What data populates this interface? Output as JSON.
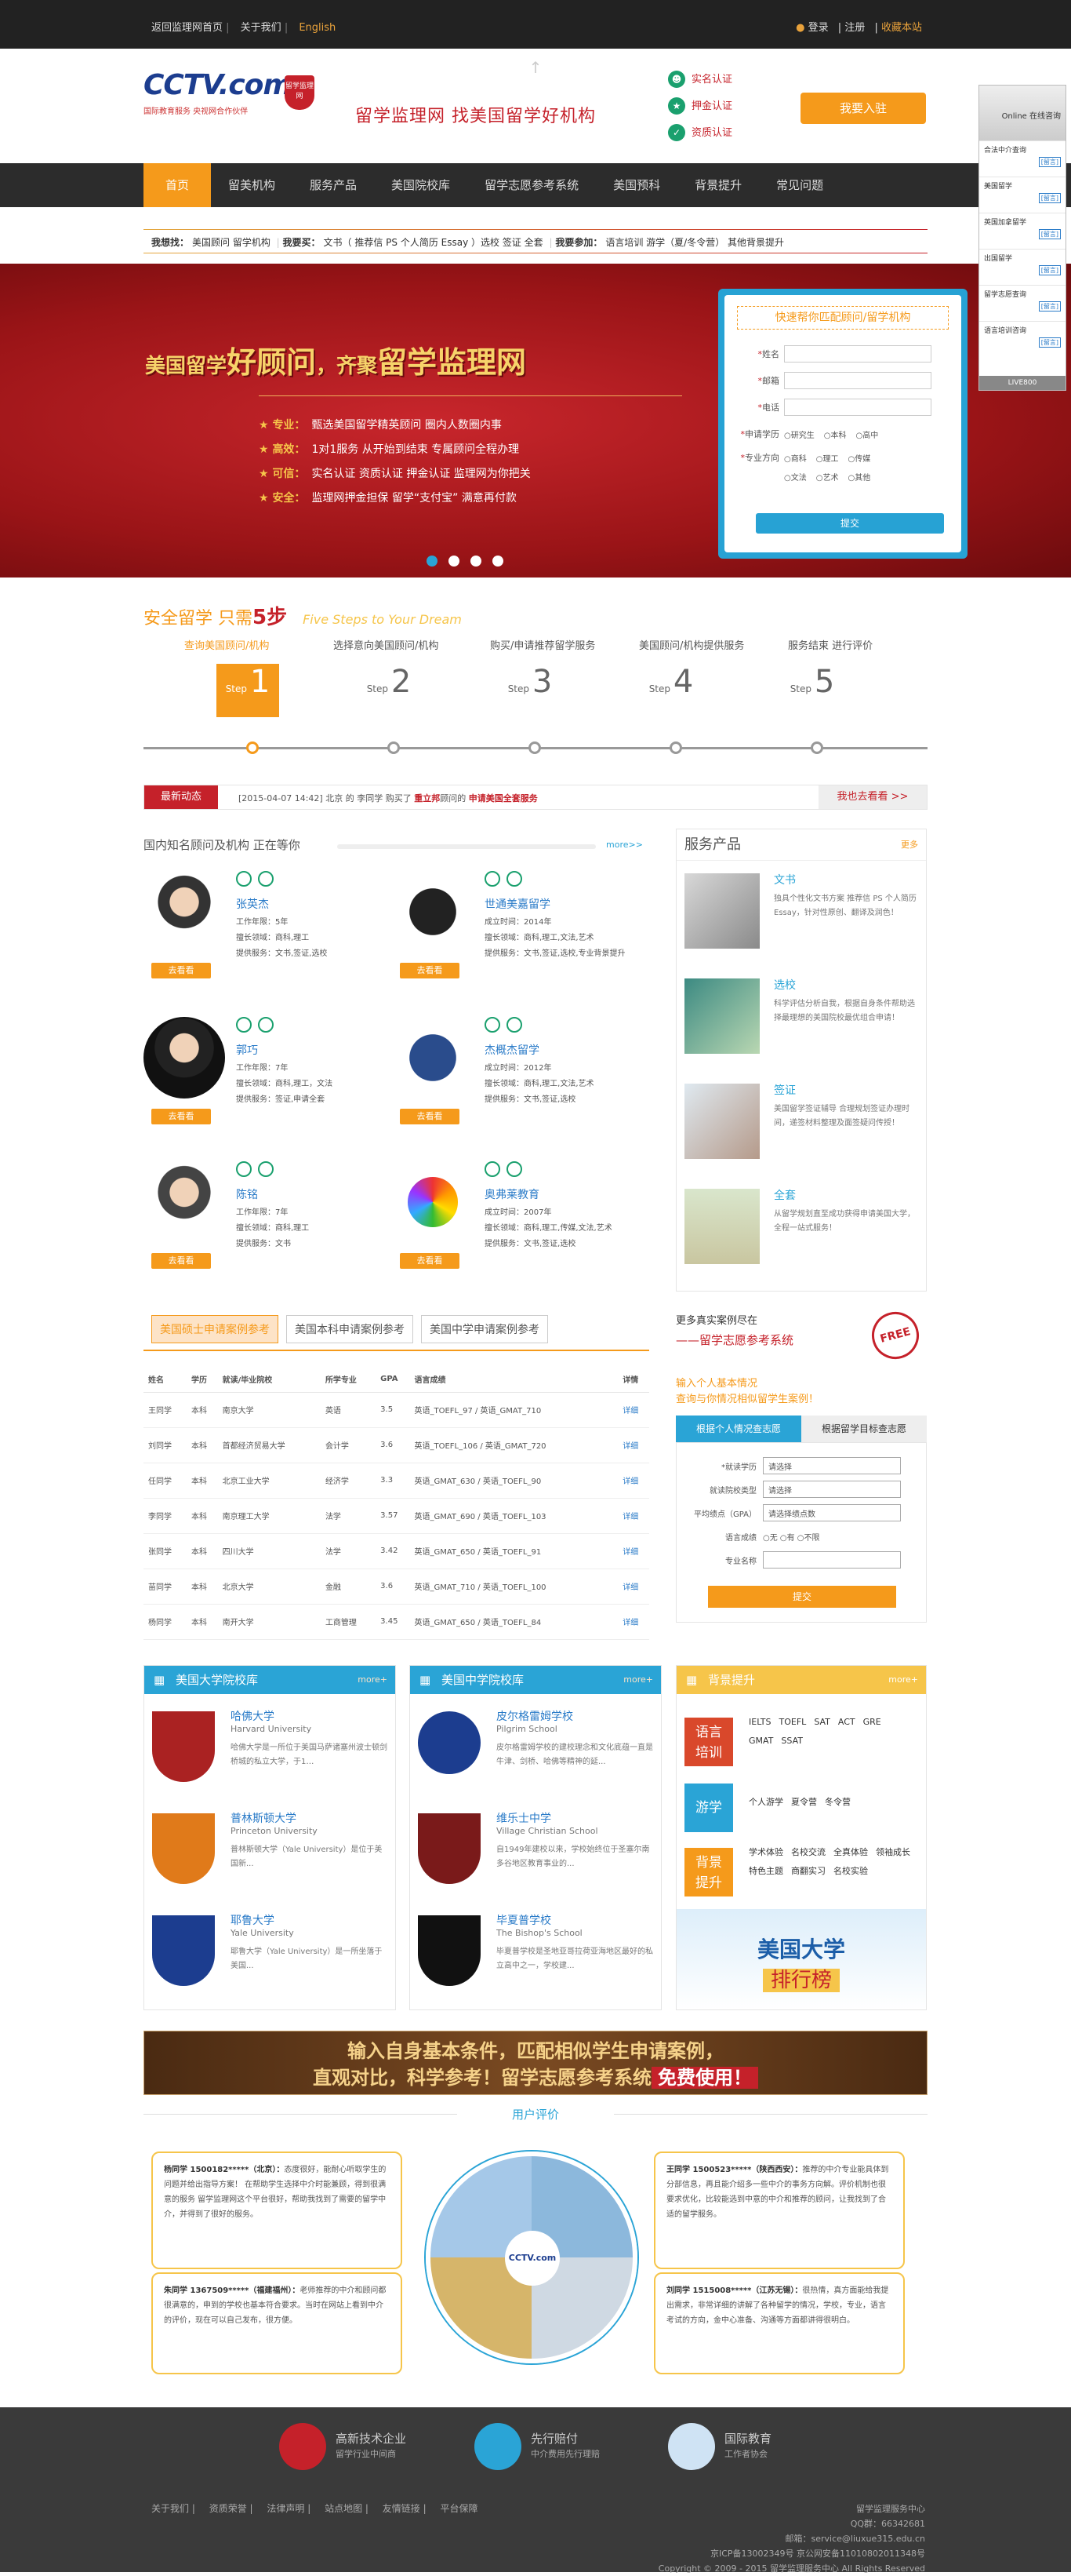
{
  "topbar": {
    "home": "返回监理网首页",
    "about": "关于我们",
    "english": "English",
    "login": "登录",
    "register": "注册",
    "favorite": "收藏本站"
  },
  "header": {
    "logo_text": "CCTV.com",
    "logo_sub": "国际教育服务   央视网合作伙伴",
    "badge": "留学监理网",
    "slogan": "留学监理网   找美国留学好机构",
    "certs": [
      "实名认证",
      "押金认证",
      "资质认证"
    ],
    "join": "我要入驻"
  },
  "nav": [
    "首页",
    "留美机构",
    "服务产品",
    "美国院校库",
    "留学志愿参考系统",
    "美国预科",
    "背景提升",
    "常见问题"
  ],
  "search_hot": {
    "l1": "我想找：",
    "v1": "美国顾问  留学机构",
    "l2": "我要买：",
    "v2": "文书（ 推荐信  PS  个人简历  Essay ）选校  签证  全套",
    "l3": "我要参加：",
    "v3": "语言培训  游学（夏/冬令营）  其他背景提升"
  },
  "banner": {
    "title_a": "美国留学",
    "title_b": "好顾问",
    "title_c": "，齐聚",
    "title_d": "留学监理网",
    "points": [
      [
        "专业：",
        "甄选美国留学精英顾问  圈内人数圈内事"
      ],
      [
        "高效：",
        "1对1服务  从开始到结束  专属顾问全程办理"
      ],
      [
        "可信：",
        "实名认证  资质认证  押金认证  监理网为你把关"
      ],
      [
        "安全：",
        "监理网押金担保  留学“支付宝”  满意再付款"
      ]
    ]
  },
  "form": {
    "title": "快速帮你匹配顾问/留学机构",
    "name": "姓名",
    "email": "邮箱",
    "phone": "电话",
    "degree": "申请学历",
    "degree_opts": [
      "研究生",
      "本科",
      "高中"
    ],
    "major": "专业方向",
    "major_opts": [
      "商科",
      "理工",
      "传媒",
      "文法",
      "艺术",
      "其他"
    ],
    "submit": "提交"
  },
  "side": {
    "online": "Online 在线咨询",
    "services": [
      "合法中介查询",
      "美国留学",
      "英国加拿留学",
      "出国留学",
      "留学志愿查询",
      "语言培训咨询"
    ],
    "ask": "[留言]",
    "live": "LIVE800"
  },
  "steps": {
    "title": "安全留学   只需",
    "five": "5步",
    "en": "Five Steps to Your Dream",
    "labels": [
      "查询美国顾问/机构",
      "选择意向美国顾问/机构",
      "购买/申请推荐留学服务",
      "美国顾问/机构提供服务",
      "服务结束  进行评价"
    ],
    "nums": [
      "1",
      "2",
      "3",
      "4",
      "5"
    ],
    "step_word": "Step"
  },
  "news": {
    "tag": "最新动态",
    "date": "[2015-04-07 14:42]",
    "text_a": "北京 的 李同学 购买了",
    "org": "重立邦",
    "text_b": "顾问的",
    "svc": "申请美国全套服务",
    "more": "我也去看看 >>"
  },
  "advisors": {
    "title": "国内知名顾问及机构  正在等你",
    "more": "more>>",
    "go": "去看看",
    "list": [
      {
        "name": "张英杰",
        "info": [
          "工作年限：5年",
          "擅长领域：商科,理工",
          "提供服务：文书,签证,选校"
        ]
      },
      {
        "name": "世通美嘉留学",
        "info": [
          "成立时间：2014年",
          "擅长领域：商科,理工,文法,艺术",
          "提供服务：文书,签证,选校,专业背景提升"
        ]
      },
      {
        "name": "郭巧",
        "info": [
          "工作年限：7年",
          "擅长领域：商科,理工，文法",
          "提供服务：签证,申请全套"
        ]
      },
      {
        "name": "杰概杰留学",
        "info": [
          "成立时间：2012年",
          "擅长领域：商科,理工,文法,艺术",
          "提供服务：文书,签证,选校"
        ]
      },
      {
        "name": "陈铭",
        "info": [
          "工作年限：7年",
          "擅长领域：商科,理工",
          "提供服务：文书"
        ]
      },
      {
        "name": "奥弗莱教育",
        "info": [
          "成立时间：2007年",
          "擅长领域：商科,理工,传媒,文法,艺术",
          "提供服务：文书,签证,选校"
        ]
      }
    ]
  },
  "services": {
    "title": "服务产品",
    "more": "更多",
    "items": [
      {
        "t": "文书",
        "d": "独具个性化文书方案 推荐信 PS 个人简历 Essay，针对性原创、翻译及润色！"
      },
      {
        "t": "选校",
        "d": "科学评估分析自我，根据自身条件帮助选择最理想的美国院校最优组合申请！"
      },
      {
        "t": "签证",
        "d": "美国留学签证辅导 合理规划签证办理时间，递签材料整理及面签疑问传授！"
      },
      {
        "t": "全套",
        "d": "从留学规划直至成功获得申请美国大学，全程一站式服务！"
      }
    ]
  },
  "case_tabs": [
    "美国硕士申请案例参考",
    "美国本科申请案例参考",
    "美国中学申请案例参考"
  ],
  "case_table": {
    "headers": [
      "姓名",
      "学历",
      "就读/毕业院校",
      "所学专业",
      "GPA",
      "语言成绩",
      "详情"
    ],
    "rows": [
      [
        "王同学",
        "本科",
        "南京大学",
        "英语",
        "3.5",
        "英语_TOEFL_97 / 英语_GMAT_710",
        "详细"
      ],
      [
        "刘同学",
        "本科",
        "首都经济贸易大学",
        "会计学",
        "3.6",
        "英语_TOEFL_106 / 英语_GMAT_720",
        "详细"
      ],
      [
        "任同学",
        "本科",
        "北京工业大学",
        "经济学",
        "3.3",
        "英语_GMAT_630 / 英语_TOEFL_90",
        "详细"
      ],
      [
        "李同学",
        "本科",
        "南京理工大学",
        "法学",
        "3.57",
        "英语_GMAT_690 / 英语_TOEFL_103",
        "详细"
      ],
      [
        "张同学",
        "本科",
        "四川大学",
        "法学",
        "3.42",
        "英语_GMAT_650 / 英语_TOEFL_91",
        "详细"
      ],
      [
        "苗同学",
        "本科",
        "北京大学",
        "金融",
        "3.6",
        "英语_GMAT_710 / 英语_TOEFL_100",
        "详细"
      ],
      [
        "杨同学",
        "本科",
        "南开大学",
        "工商管理",
        "3.45",
        "英语_GMAT_650 / 英语_TOEFL_84",
        "详细"
      ]
    ]
  },
  "case_search": {
    "t1": "更多真实案例尽在",
    "t2": "——留学志愿参考系统",
    "free": "FREE",
    "t3a": "输入个人基本情况",
    "t3b": "查询与你情况相似留学生案例！",
    "tab1": "根据个人情况查志愿",
    "tab2": "根据留学目标查志愿",
    "rows": [
      [
        "*就读学历",
        "请选择"
      ],
      [
        "就读院校类型",
        "请选择"
      ],
      [
        "平均绩点（GPA）",
        "请选择绩点数"
      ],
      [
        "语言成绩",
        "○无  ○有  ○不限"
      ],
      [
        "专业名称",
        ""
      ]
    ],
    "btn": "提交"
  },
  "uni_lib": {
    "title": "美国大学院校库",
    "more": "more+",
    "items": [
      {
        "n": "哈佛大学",
        "en": "Harvard University",
        "d": "哈佛大学是一所位于美国马萨诸塞州波士顿剑桥城的私立大学，于1…"
      },
      {
        "n": "普林斯顿大学",
        "en": "Princeton University",
        "d": "普林斯顿大学（Yale University）是位于美国新..."
      },
      {
        "n": "耶鲁大学",
        "en": "Yale University",
        "d": "耶鲁大学（Yale University）是一所坐落于美国..."
      }
    ]
  },
  "hs_lib": {
    "title": "美国中学院校库",
    "more": "more+",
    "items": [
      {
        "n": "皮尔格雷姆学校",
        "en": "Pilgrim School",
        "d": "皮尔格雷姆学校的建校理念和文化底蕴一直是牛津、剑桥、哈佛等精神的延..."
      },
      {
        "n": "维乐士中学",
        "en": "Village Christian School",
        "d": "自1949年建校以来，学校始终位于圣塞尔南多谷地区教育事业的..."
      },
      {
        "n": "毕夏普学校",
        "en": "The Bishop's School",
        "d": "毕夏普学校是圣地亚哥拉荷亚海地区最好的私立高中之一，学校建..."
      }
    ]
  },
  "bglift": {
    "title": "背景提升",
    "more": "more+",
    "blocks": [
      [
        "语言",
        "培训"
      ],
      [
        "游学",
        ""
      ],
      [
        "背景",
        "提升"
      ]
    ],
    "tags1": [
      "IELTS",
      "TOEFL",
      "SAT",
      "ACT",
      "GRE",
      "GMAT",
      "SSAT"
    ],
    "tags2": [
      "个人游学",
      "夏令营",
      "冬令营"
    ],
    "tags3": [
      "学术体验",
      "名校交流",
      "全真体验",
      "领袖成长",
      "特色主题",
      "商翻实习",
      "名校实验"
    ],
    "rank_a": "美国大学",
    "rank_b": "排行榜"
  },
  "promo": {
    "l1": "输入自身基本条件，匹配相似学生申请案例，",
    "l2a": "直观对比，科学参考！留学志愿参考系统",
    "l2b": "免费使用！"
  },
  "reviews": {
    "title": "用户评价",
    "items": [
      {
        "who": "杨同学 1500182*****（北京）：",
        "t": "态度很好，能耐心听取学生的问题并给出指导方案！ 在帮助学生选择中介时能兼顾，得到很满意的服务 留学监理网这个平台很好，帮助我找到了需要的留学中介，并得到了很好的服务。"
      },
      {
        "who": "王同学 1500523*****（陕西西安）：",
        "t": "推荐的中介专业能具体到分部信息，再且能介绍多一些中介的事务方向解。评价机制也很要求优化，比较能选到中意的中介和推荐的顾问，让我找到了合适的留学服务。"
      },
      {
        "who": "朱同学 1367509*****（福建福州）：",
        "t": "老师推荐的中介和顾问都很满意的，申到的学校也基本符合要求。当时在网站上看到中介的评价，现在可以自己发布，很方便。"
      },
      {
        "who": "刘同学 1515008*****（江苏无锡）：",
        "t": "很热情，真方面能给我提出需求，非常详细的讲解了各种留学的情况，学校，专业，语言考试的方向，金中心准备、沟通等方面都讲得很明白。"
      }
    ],
    "center": "CCTV.com"
  },
  "footer": {
    "logos": [
      [
        "高新技术企业",
        "留学行业中间商"
      ],
      [
        "先行赔付",
        "中介费用先行理赔"
      ],
      [
        "国际教育",
        "工作者协会"
      ]
    ],
    "links": [
      "关于我们",
      "资质荣誉",
      "法律声明",
      "站点地图",
      "友情链接",
      "平台保障"
    ],
    "right": [
      "留学监理服务中心",
      "QQ群：66342681",
      "邮箱：service@liuxue315.edu.cn",
      "京ICP备13002349号  京公网安备11010802011348号",
      "Copyright © 2009 - 2015 留学监理服务中心 All Rights Reserved"
    ]
  }
}
